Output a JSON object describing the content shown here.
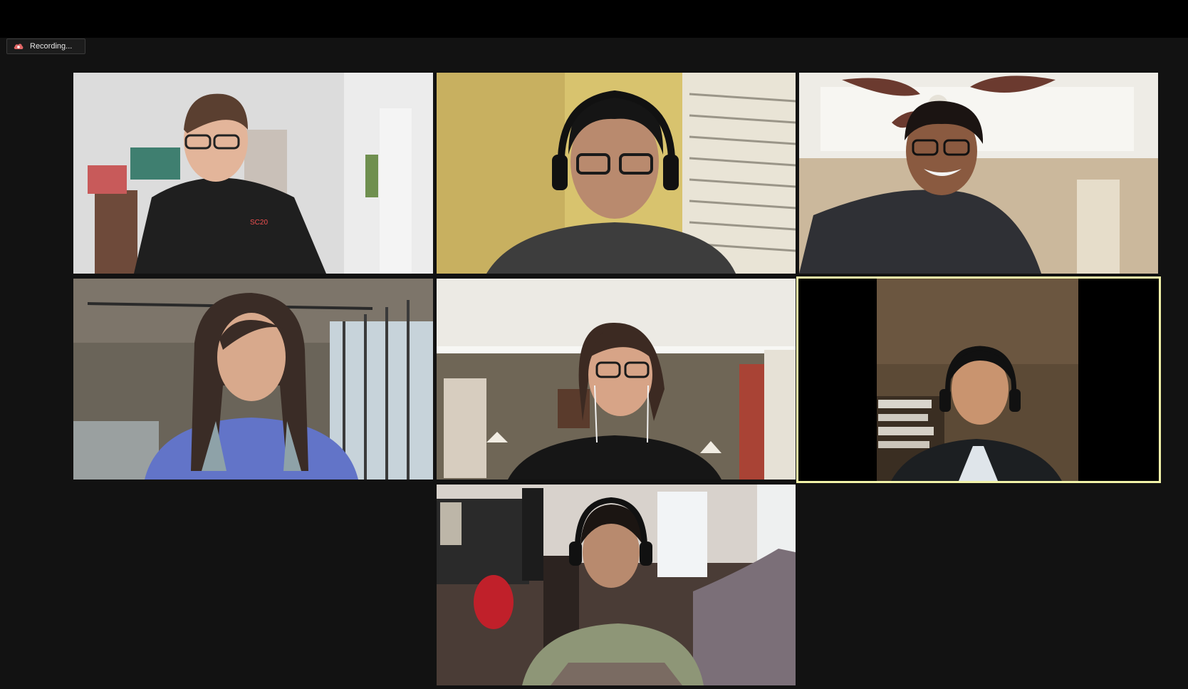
{
  "recording": {
    "label": "Recording...",
    "icon": "cloud-record-icon",
    "icon_color": "#e06666"
  },
  "active_speaker_color": "#f1f2a8",
  "participants": [
    {
      "tile": "participant-tile-1",
      "shirt_logo": "SC20"
    },
    {
      "tile": "participant-tile-2"
    },
    {
      "tile": "participant-tile-3"
    },
    {
      "tile": "participant-tile-4"
    },
    {
      "tile": "participant-tile-5"
    },
    {
      "tile": "participant-tile-6",
      "active_speaker": true
    },
    {
      "tile": "participant-tile-7"
    }
  ]
}
